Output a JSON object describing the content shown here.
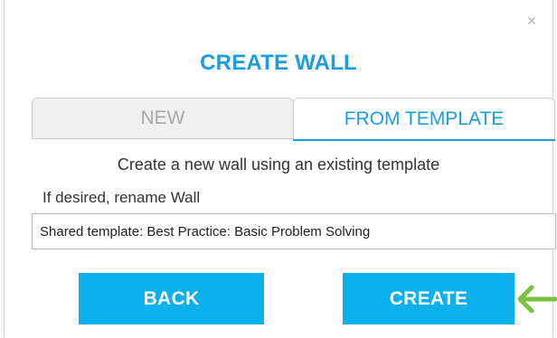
{
  "dialog": {
    "close_glyph": "×",
    "title": "CREATE WALL",
    "tabs": [
      {
        "label": "NEW",
        "active": false
      },
      {
        "label": "FROM TEMPLATE",
        "active": true
      }
    ],
    "description": "Create a new wall using an existing template",
    "rename_label": "If desired, rename Wall",
    "template_field": {
      "value": "Shared template: Best Practice: Basic Problem Solving"
    },
    "buttons": {
      "back": "BACK",
      "create": "CREATE"
    }
  },
  "annotation": {
    "arrow_icon": "left-arrow-icon",
    "arrow_color": "#7ac143"
  },
  "colors": {
    "accent": "#1a9ee0",
    "button": "#0cb0ec",
    "inactive_tab_bg": "#f0f0f0",
    "inactive_tab_text": "#a9a9a9"
  }
}
